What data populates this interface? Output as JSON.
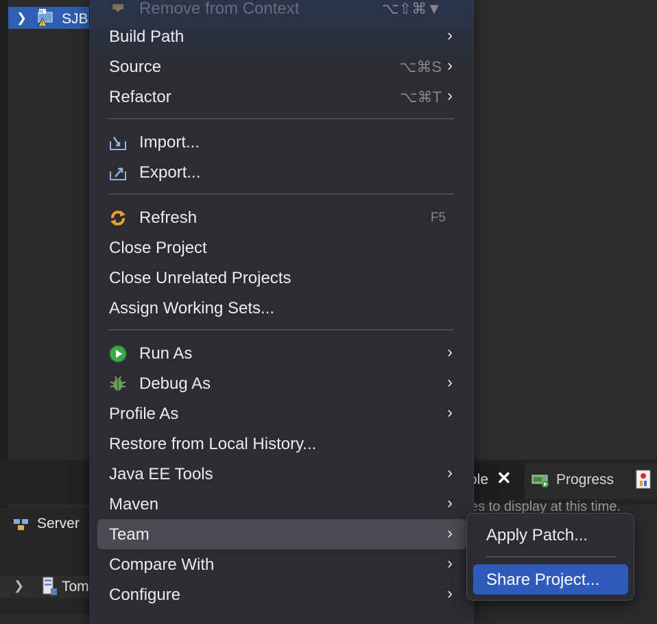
{
  "project_explorer": {
    "project_label": "SJB"
  },
  "bottom_panel": {
    "console_tab_label": "ole",
    "progress_tab_label": "Progress",
    "status_message": "es to display at this time.",
    "servers_tab_label": "Server",
    "server_entry_label": "Tom"
  },
  "context_menu": {
    "items": [
      {
        "label": "Remove from Context",
        "shortcut": "⌥⇧⌘▼",
        "disabled": true,
        "icon": "remove-context-icon"
      },
      {
        "label": "Build Path",
        "submenu": true
      },
      {
        "label": "Source",
        "shortcut": "⌥⌘S",
        "submenu": true
      },
      {
        "label": "Refactor",
        "shortcut": "⌥⌘T",
        "submenu": true
      },
      {
        "label": "Import...",
        "icon": "import-icon"
      },
      {
        "label": "Export...",
        "icon": "export-icon"
      },
      {
        "label": "Refresh",
        "shortcut": "F5",
        "icon": "refresh-icon"
      },
      {
        "label": "Close Project"
      },
      {
        "label": "Close Unrelated Projects"
      },
      {
        "label": "Assign Working Sets..."
      },
      {
        "label": "Run As",
        "submenu": true,
        "icon": "run-icon"
      },
      {
        "label": "Debug As",
        "submenu": true,
        "icon": "debug-bug-icon"
      },
      {
        "label": "Profile As",
        "submenu": true
      },
      {
        "label": "Restore from Local History..."
      },
      {
        "label": "Java EE Tools",
        "submenu": true
      },
      {
        "label": "Maven",
        "submenu": true
      },
      {
        "label": "Team",
        "submenu": true,
        "highlighted": true
      },
      {
        "label": "Compare With",
        "submenu": true
      },
      {
        "label": "Configure",
        "submenu": true
      }
    ]
  },
  "team_submenu": {
    "items": [
      {
        "label": "Apply Patch..."
      },
      {
        "label": "Share Project...",
        "selected": true
      }
    ]
  },
  "colors": {
    "menu_background": "#2c2d33",
    "highlight": "#4a4b52",
    "selection_blue": "#2f5bbd",
    "tree_selection": "#2f5fb0"
  }
}
